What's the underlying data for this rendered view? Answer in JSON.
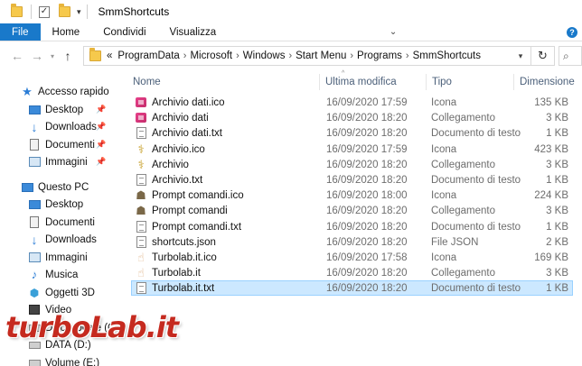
{
  "window": {
    "title": "SmmShortcuts"
  },
  "ribbon": {
    "tabs": [
      "File",
      "Home",
      "Condividi",
      "Visualizza"
    ]
  },
  "address": {
    "prefix": "«",
    "crumbs": [
      "ProgramData",
      "Microsoft",
      "Windows",
      "Start Menu",
      "Programs",
      "SmmShortcuts"
    ]
  },
  "navpane": {
    "quick_access": "Accesso rapido",
    "quick_items": [
      "Desktop",
      "Downloads",
      "Documenti",
      "Immagini"
    ],
    "this_pc": "Questo PC",
    "pc_items": [
      "Desktop",
      "Documenti",
      "Downloads",
      "Immagini",
      "Musica",
      "Oggetti 3D",
      "Video",
      "Disco locale (C:)",
      "DATA (D:)",
      "Volume (E:)"
    ]
  },
  "columns": {
    "name": "Nome",
    "date": "Ultima modifica",
    "type": "Tipo",
    "size": "Dimensione"
  },
  "files": [
    {
      "name": "Archivio dati.ico",
      "date": "16/09/2020 17:59",
      "type": "Icona",
      "size": "135 KB",
      "icon": "archivio-icon"
    },
    {
      "name": "Archivio dati",
      "date": "16/09/2020 18:20",
      "type": "Collegamento",
      "size": "3 KB",
      "icon": "archivio-icon"
    },
    {
      "name": "Archivio dati.txt",
      "date": "16/09/2020 18:20",
      "type": "Documento di testo",
      "size": "1 KB",
      "icon": "text-doc-icon"
    },
    {
      "name": "Archivio.ico",
      "date": "16/09/2020 17:59",
      "type": "Icona",
      "size": "423 KB",
      "icon": "caduceus-icon"
    },
    {
      "name": "Archivio",
      "date": "16/09/2020 18:20",
      "type": "Collegamento",
      "size": "3 KB",
      "icon": "caduceus-icon"
    },
    {
      "name": "Archivio.txt",
      "date": "16/09/2020 18:20",
      "type": "Documento di testo",
      "size": "1 KB",
      "icon": "text-doc-icon"
    },
    {
      "name": "Prompt comandi.ico",
      "date": "16/09/2020 18:00",
      "type": "Icona",
      "size": "224 KB",
      "icon": "prompt-icon"
    },
    {
      "name": "Prompt comandi",
      "date": "16/09/2020 18:20",
      "type": "Collegamento",
      "size": "3 KB",
      "icon": "prompt-icon"
    },
    {
      "name": "Prompt comandi.txt",
      "date": "16/09/2020 18:20",
      "type": "Documento di testo",
      "size": "1 KB",
      "icon": "text-doc-icon"
    },
    {
      "name": "shortcuts.json",
      "date": "16/09/2020 18:20",
      "type": "File JSON",
      "size": "2 KB",
      "icon": "json-doc-icon"
    },
    {
      "name": "Turbolab.it.ico",
      "date": "16/09/2020 17:58",
      "type": "Icona",
      "size": "169 KB",
      "icon": "turbolab-icon"
    },
    {
      "name": "Turbolab.it",
      "date": "16/09/2020 18:20",
      "type": "Collegamento",
      "size": "3 KB",
      "icon": "turbolab-icon"
    },
    {
      "name": "Turbolab.it.txt",
      "date": "16/09/2020 18:20",
      "type": "Documento di testo",
      "size": "1 KB",
      "icon": "text-doc-icon",
      "selected": true
    }
  ],
  "watermark": "turboLab.it",
  "colors": {
    "accent": "#1979ca",
    "selection": "#cce8ff",
    "selection_border": "#99d1ff",
    "watermark": "#c52a1f"
  }
}
